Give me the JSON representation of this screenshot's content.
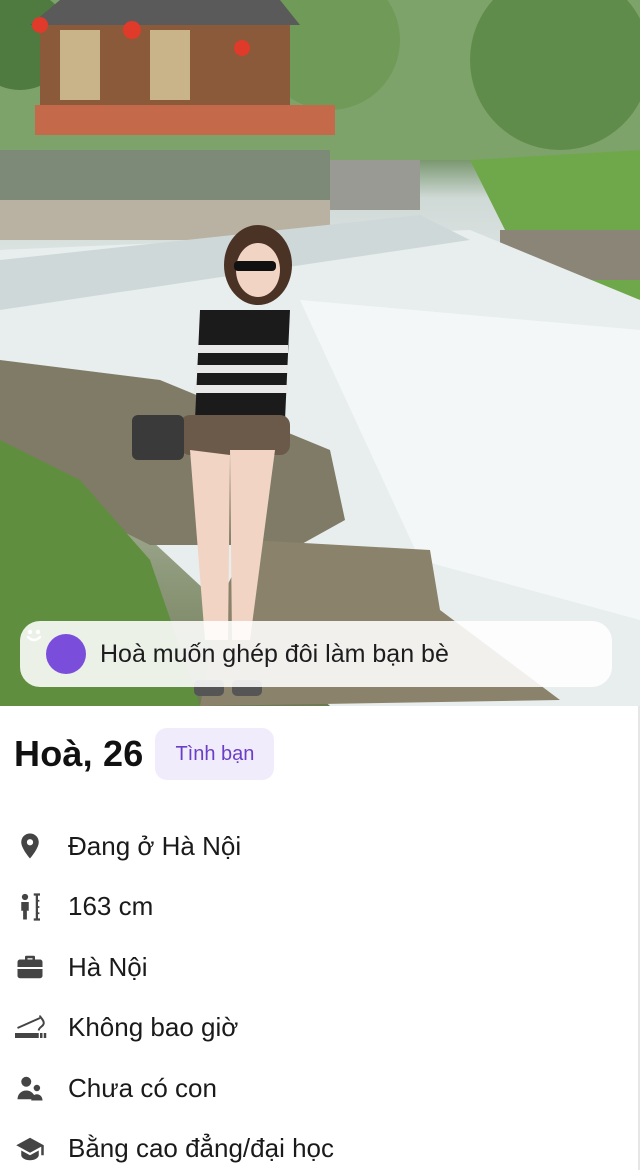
{
  "profile": {
    "name_age": "Hoà, 26",
    "relationship_badge": "Tình bạn",
    "match_banner": "Hoà muốn ghép đôi làm bạn bè",
    "details": [
      {
        "icon": "location-pin-icon",
        "text": "Đang ở Hà Nội"
      },
      {
        "icon": "height-icon",
        "text": "163 cm"
      },
      {
        "icon": "briefcase-icon",
        "text": "Hà Nội"
      },
      {
        "icon": "smoking-icon",
        "text": "Không bao giờ"
      },
      {
        "icon": "children-icon",
        "text": "Chưa có con"
      },
      {
        "icon": "graduation-cap-icon",
        "text": "Bằng cao đẳng/đại học"
      }
    ]
  },
  "colors": {
    "accent": "#7b4ddb",
    "badge_bg": "#f1ecfb",
    "badge_text": "#6a3fc8",
    "icon": "#444444"
  }
}
